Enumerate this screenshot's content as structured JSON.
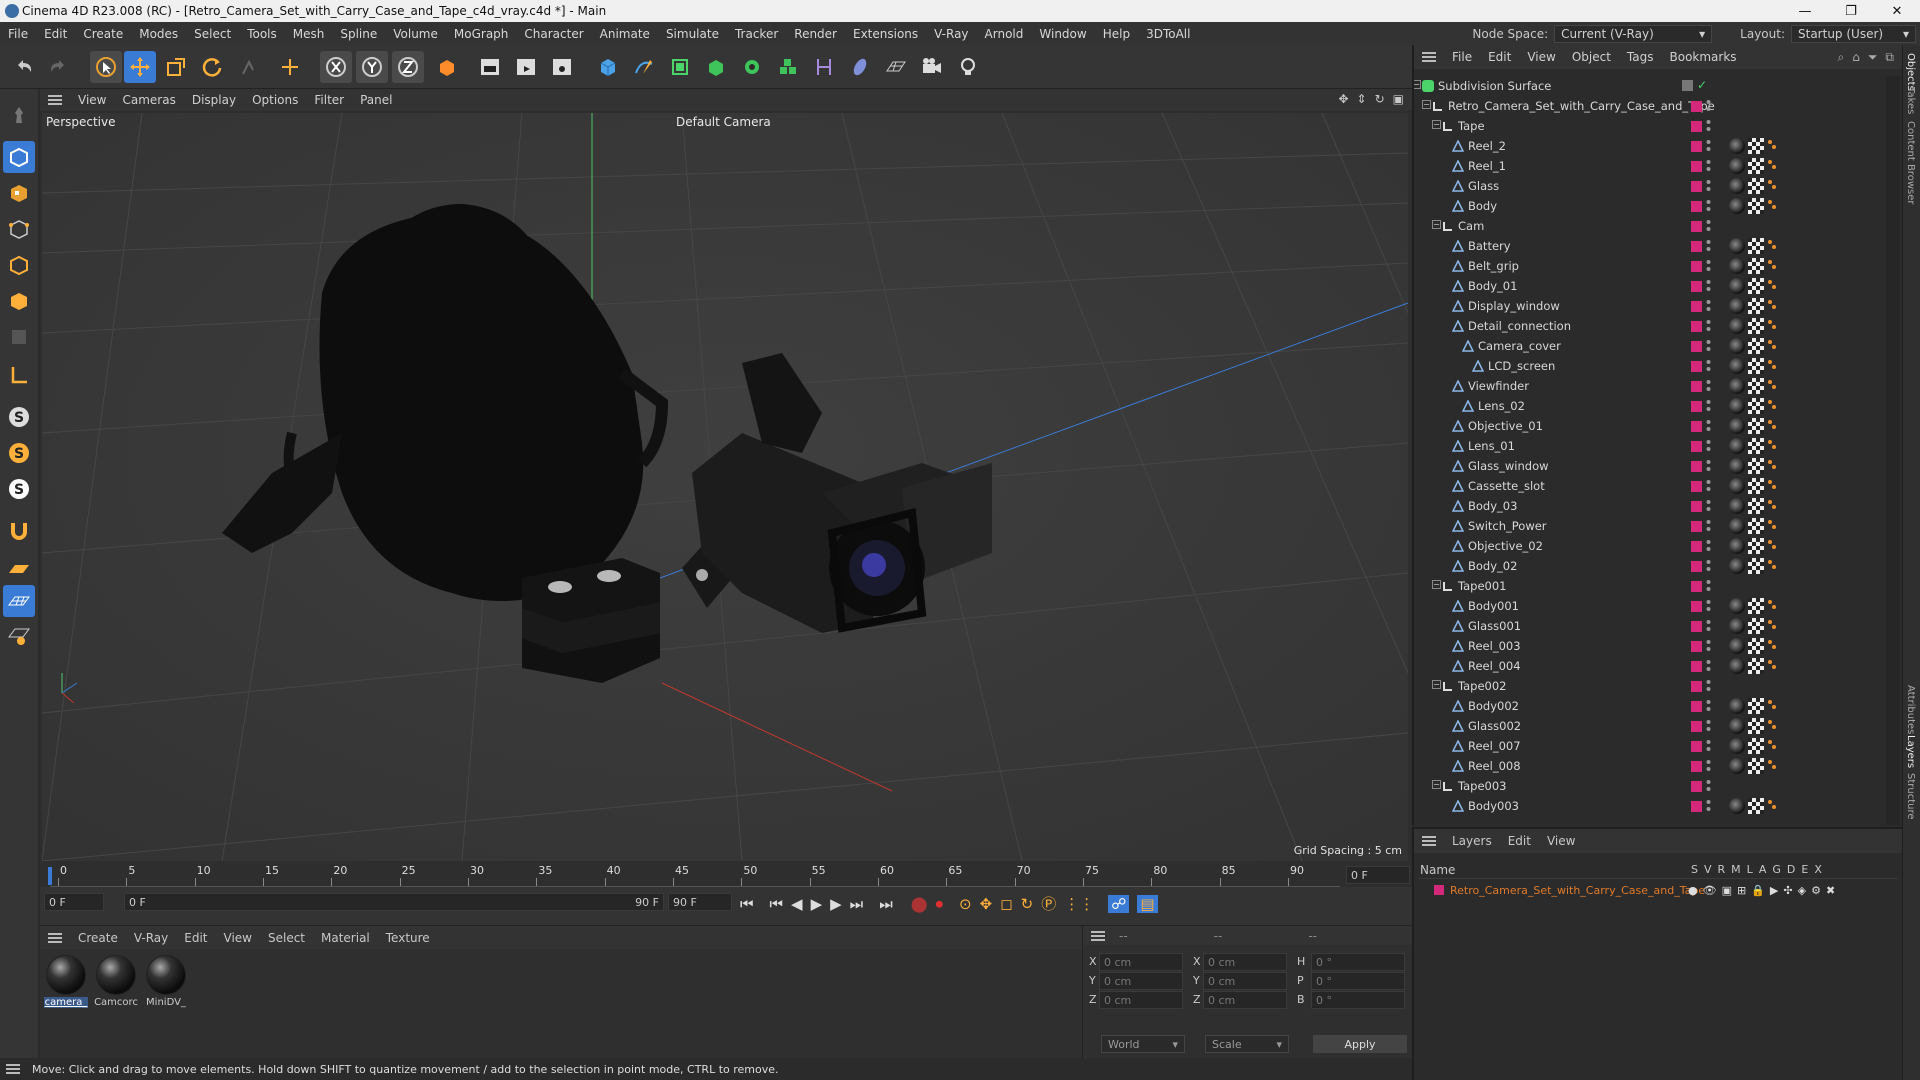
{
  "window": {
    "title": "Cinema 4D R23.008 (RC) - [Retro_Camera_Set_with_Carry_Case_and_Tape_c4d_vray.c4d *] - Main",
    "min": "—",
    "max": "❐",
    "close": "✕"
  },
  "menu": [
    "File",
    "Edit",
    "Create",
    "Modes",
    "Select",
    "Tools",
    "Mesh",
    "Spline",
    "Volume",
    "MoGraph",
    "Character",
    "Animate",
    "Simulate",
    "Tracker",
    "Render",
    "Extensions",
    "V-Ray",
    "Arnold",
    "Window",
    "Help",
    "3DToAll"
  ],
  "node_space": {
    "label": "Node Space:",
    "value": "Current (V-Ray)"
  },
  "layout": {
    "label": "Layout:",
    "value": "Startup (User)"
  },
  "viewport": {
    "menu": [
      "View",
      "Cameras",
      "Display",
      "Options",
      "Filter",
      "Panel"
    ],
    "name": "Perspective",
    "camera": "Default Camera",
    "grid_spacing": "Grid Spacing : 5 cm"
  },
  "timeline": {
    "ticks": [
      "0",
      "5",
      "10",
      "15",
      "20",
      "25",
      "30",
      "35",
      "40",
      "45",
      "50",
      "55",
      "60",
      "65",
      "70",
      "75",
      "80",
      "85",
      "90"
    ],
    "end_frame": "0 F",
    "current": "0 F",
    "range_start": "0 F",
    "range_end": "90 F",
    "max": "90 F"
  },
  "materials": {
    "menu": [
      "Create",
      "V-Ray",
      "Edit",
      "View",
      "Select",
      "Material",
      "Texture"
    ],
    "items": [
      {
        "label": "camera_",
        "selected": true
      },
      {
        "label": "Camcorc",
        "selected": false
      },
      {
        "label": "MiniDV_",
        "selected": false
      }
    ]
  },
  "coords": {
    "dashes": [
      "--",
      "--",
      "--"
    ],
    "rows": [
      {
        "a": "X",
        "av": "0 cm",
        "b": "X",
        "bv": "0 cm",
        "c": "H",
        "cv": "0 °"
      },
      {
        "a": "Y",
        "av": "0 cm",
        "b": "Y",
        "bv": "0 cm",
        "c": "P",
        "cv": "0 °"
      },
      {
        "a": "Z",
        "av": "0 cm",
        "b": "Z",
        "bv": "0 cm",
        "c": "B",
        "cv": "0 °"
      }
    ],
    "world": "World",
    "scale": "Scale",
    "apply": "Apply"
  },
  "status": "Move: Click and drag to move elements. Hold down SHIFT to quantize movement / add to the selection in point mode, CTRL to remove.",
  "objects": {
    "menu": [
      "File",
      "Edit",
      "View",
      "Object",
      "Tags",
      "Bookmarks"
    ],
    "rows": [
      {
        "name": "Subdivision Surface",
        "level": 0,
        "type": "subdiv",
        "tags": false
      },
      {
        "name": "Retro_Camera_Set_with_Carry_Case_and_Tape",
        "level": 1,
        "type": "null",
        "tags": false
      },
      {
        "name": "Tape",
        "level": 2,
        "type": "null",
        "tags": false
      },
      {
        "name": "Reel_2",
        "level": 3,
        "type": "mesh",
        "tags": true
      },
      {
        "name": "Reel_1",
        "level": 3,
        "type": "mesh",
        "tags": true
      },
      {
        "name": "Glass",
        "level": 3,
        "type": "mesh",
        "tags": true
      },
      {
        "name": "Body",
        "level": 3,
        "type": "mesh",
        "tags": true
      },
      {
        "name": "Cam",
        "level": 2,
        "type": "null",
        "tags": false
      },
      {
        "name": "Battery",
        "level": 3,
        "type": "mesh",
        "tags": true
      },
      {
        "name": "Belt_grip",
        "level": 3,
        "type": "mesh",
        "tags": true
      },
      {
        "name": "Body_01",
        "level": 3,
        "type": "mesh",
        "tags": true
      },
      {
        "name": "Display_window",
        "level": 3,
        "type": "mesh",
        "tags": true
      },
      {
        "name": "Detail_connection",
        "level": 3,
        "type": "mesh",
        "tags": true
      },
      {
        "name": "Camera_cover",
        "level": 4,
        "type": "mesh",
        "tags": true
      },
      {
        "name": "LCD_screen",
        "level": 5,
        "type": "mesh",
        "tags": true
      },
      {
        "name": "Viewfinder",
        "level": 3,
        "type": "mesh",
        "tags": true
      },
      {
        "name": "Lens_02",
        "level": 4,
        "type": "mesh",
        "tags": true
      },
      {
        "name": "Objective_01",
        "level": 3,
        "type": "mesh",
        "tags": true
      },
      {
        "name": "Lens_01",
        "level": 3,
        "type": "mesh",
        "tags": true
      },
      {
        "name": "Glass_window",
        "level": 3,
        "type": "mesh",
        "tags": true
      },
      {
        "name": "Cassette_slot",
        "level": 3,
        "type": "mesh",
        "tags": true
      },
      {
        "name": "Body_03",
        "level": 3,
        "type": "mesh",
        "tags": true
      },
      {
        "name": "Switch_Power",
        "level": 3,
        "type": "mesh",
        "tags": true
      },
      {
        "name": "Objective_02",
        "level": 3,
        "type": "mesh",
        "tags": true
      },
      {
        "name": "Body_02",
        "level": 3,
        "type": "mesh",
        "tags": true
      },
      {
        "name": "Tape001",
        "level": 2,
        "type": "null",
        "tags": false
      },
      {
        "name": "Body001",
        "level": 3,
        "type": "mesh",
        "tags": true
      },
      {
        "name": "Glass001",
        "level": 3,
        "type": "mesh",
        "tags": true
      },
      {
        "name": "Reel_003",
        "level": 3,
        "type": "mesh",
        "tags": true
      },
      {
        "name": "Reel_004",
        "level": 3,
        "type": "mesh",
        "tags": true
      },
      {
        "name": "Tape002",
        "level": 2,
        "type": "null",
        "tags": false
      },
      {
        "name": "Body002",
        "level": 3,
        "type": "mesh",
        "tags": true
      },
      {
        "name": "Glass002",
        "level": 3,
        "type": "mesh",
        "tags": true
      },
      {
        "name": "Reel_007",
        "level": 3,
        "type": "mesh",
        "tags": true
      },
      {
        "name": "Reel_008",
        "level": 3,
        "type": "mesh",
        "tags": true
      },
      {
        "name": "Tape003",
        "level": 2,
        "type": "null",
        "tags": false
      },
      {
        "name": "Body003",
        "level": 3,
        "type": "mesh",
        "tags": true
      }
    ]
  },
  "layers": {
    "menu": [
      "Layers",
      "Edit",
      "View"
    ],
    "header_name": "Name",
    "cols": [
      "S",
      "V",
      "R",
      "M",
      "L",
      "A",
      "G",
      "D",
      "E",
      "X"
    ],
    "item": "Retro_Camera_Set_with_Carry_Case_and_Tape"
  },
  "side_tabs": [
    "Objects",
    "Takes",
    "Content Browser",
    "Attributes",
    "Layers",
    "Structure"
  ],
  "colors": {
    "accent": "#d4297a",
    "layer_text": "#e07a2a",
    "active_blue": "#3a7bd5"
  }
}
